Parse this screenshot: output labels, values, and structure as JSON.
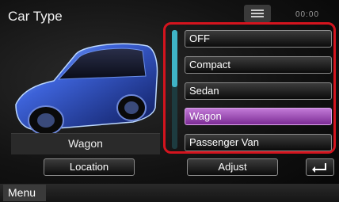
{
  "header": {
    "title": "Car Type",
    "clock": "00:00",
    "header_icon": "list-toggle-icon"
  },
  "preview": {
    "current_label": "Wagon",
    "image_icon": "car-wagon-illustration"
  },
  "options": [
    {
      "label": "OFF",
      "selected": false
    },
    {
      "label": "Compact",
      "selected": false
    },
    {
      "label": "Sedan",
      "selected": false
    },
    {
      "label": "Wagon",
      "selected": true
    },
    {
      "label": "Passenger Van",
      "selected": false
    }
  ],
  "scroll": {
    "position": 0
  },
  "buttons": {
    "location": "Location",
    "adjust": "Adjust",
    "back_icon": "return-arrow-icon"
  },
  "footer": {
    "menu_label": "Menu"
  },
  "colors": {
    "highlight_frame": "#d4141e",
    "selected_option": "#9a43b4",
    "scroll_accent": "#3fb3c6"
  }
}
